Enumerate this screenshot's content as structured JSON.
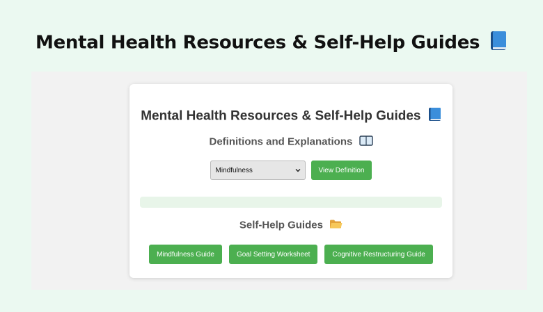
{
  "page": {
    "title": "Mental Health Resources & Self-Help Guides"
  },
  "card": {
    "title": "Mental Health Resources & Self-Help Guides",
    "definitions": {
      "heading": "Definitions and Explanations",
      "selected_term": "Mindfulness",
      "button_label": "View Definition",
      "output_text": ""
    },
    "guides": {
      "heading": "Self-Help Guides",
      "buttons": [
        "Mindfulness Guide",
        "Goal Setting Worksheet",
        "Cognitive Restructuring Guide"
      ]
    }
  },
  "icons": {
    "title": "blue-book-icon",
    "definitions": "open-book-icon",
    "guides": "folder-icon",
    "select": "chevron-down-icon"
  },
  "colors": {
    "page_background": "#ebf9f1",
    "panel_background": "#f2f2f2",
    "button": "#4caf50",
    "output_box": "#e8f5e9"
  }
}
